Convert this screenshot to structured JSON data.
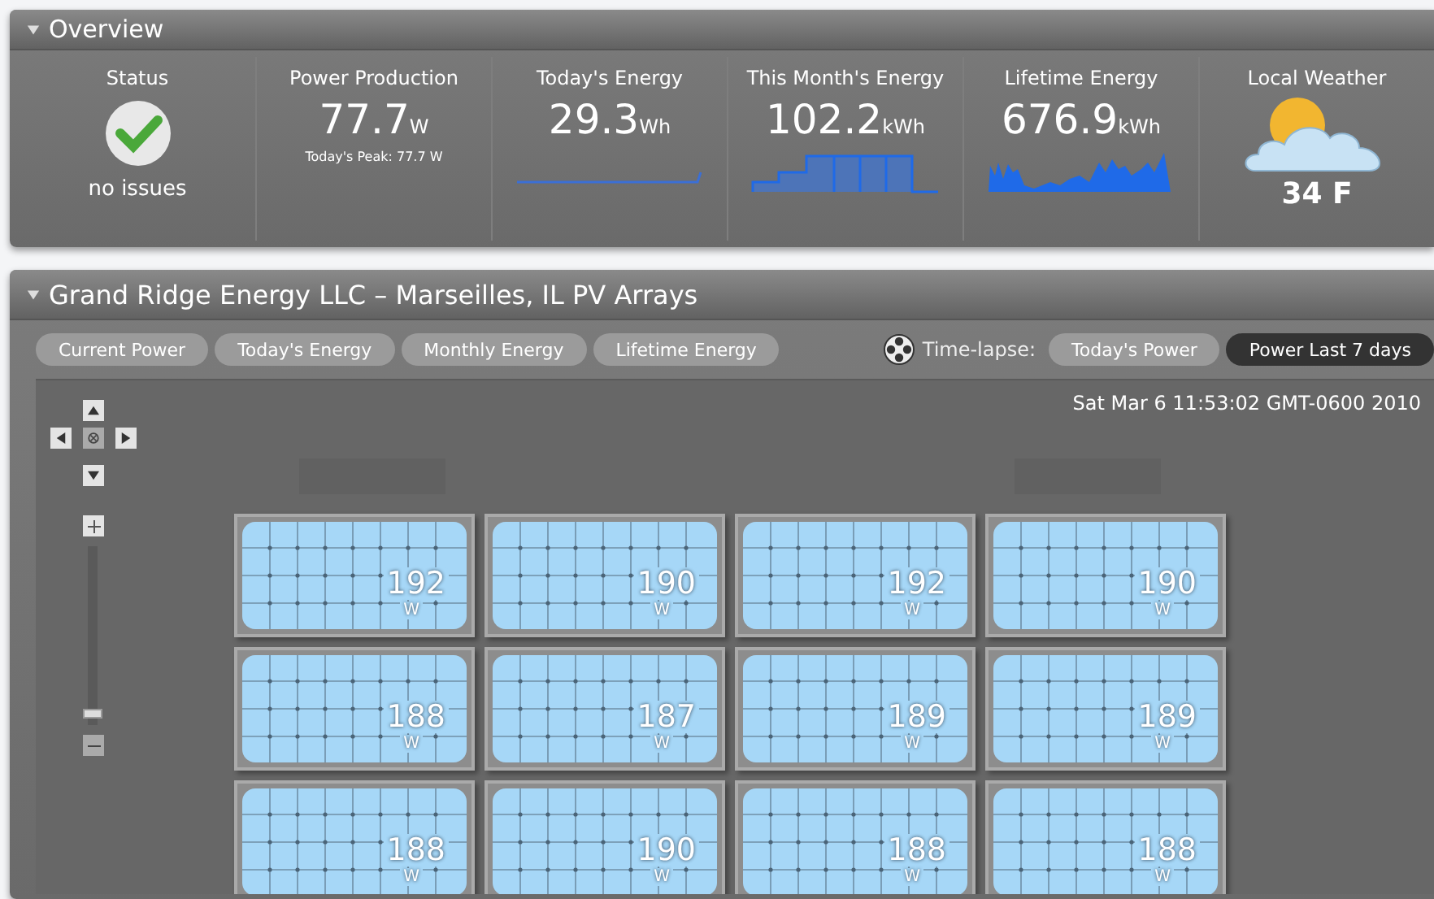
{
  "overview": {
    "title": "Overview",
    "expanded": true,
    "columns": [
      {
        "kind": "status",
        "title": "Status",
        "caption": "no issues"
      },
      {
        "kind": "peak",
        "title": "Power Production",
        "value": "77.7",
        "unit": "W",
        "note": "Today's Peak: 77.7 W"
      },
      {
        "kind": "line",
        "title": "Today's Energy",
        "value": "29.3",
        "unit": "Wh"
      },
      {
        "kind": "bars",
        "title": "This Month's Energy",
        "value": "102.2",
        "unit": "kWh"
      },
      {
        "kind": "area",
        "title": "Lifetime Energy",
        "value": "676.9",
        "unit": "kWh"
      },
      {
        "kind": "weather",
        "title": "Local Weather",
        "temperature": "34 F"
      }
    ]
  },
  "arrays": {
    "title": "Grand Ridge Energy LLC – Marseilles, IL PV Arrays",
    "expanded": true,
    "views": [
      {
        "label": "Current Power",
        "selected": false
      },
      {
        "label": "Today's Energy",
        "selected": false
      },
      {
        "label": "Monthly Energy",
        "selected": false
      },
      {
        "label": "Lifetime Energy",
        "selected": false
      }
    ],
    "timelapse_label": "Time-lapse:",
    "timelapse": [
      {
        "label": "Today's Power",
        "selected": false
      },
      {
        "label": "Power Last 7 days",
        "selected": true
      }
    ],
    "timestamp": "Sat Mar 6 11:53:02 GMT-0600 2010",
    "zoom": {
      "level": 0.04
    },
    "panels": [
      {
        "value": "192",
        "unit": "W"
      },
      {
        "value": "190",
        "unit": "W"
      },
      {
        "value": "192",
        "unit": "W"
      },
      {
        "value": "190",
        "unit": "W"
      },
      {
        "value": "188",
        "unit": "W"
      },
      {
        "value": "187",
        "unit": "W"
      },
      {
        "value": "189",
        "unit": "W"
      },
      {
        "value": "189",
        "unit": "W"
      },
      {
        "value": "188",
        "unit": "W"
      },
      {
        "value": "190",
        "unit": "W"
      },
      {
        "value": "188",
        "unit": "W"
      },
      {
        "value": "188",
        "unit": "W"
      }
    ]
  }
}
